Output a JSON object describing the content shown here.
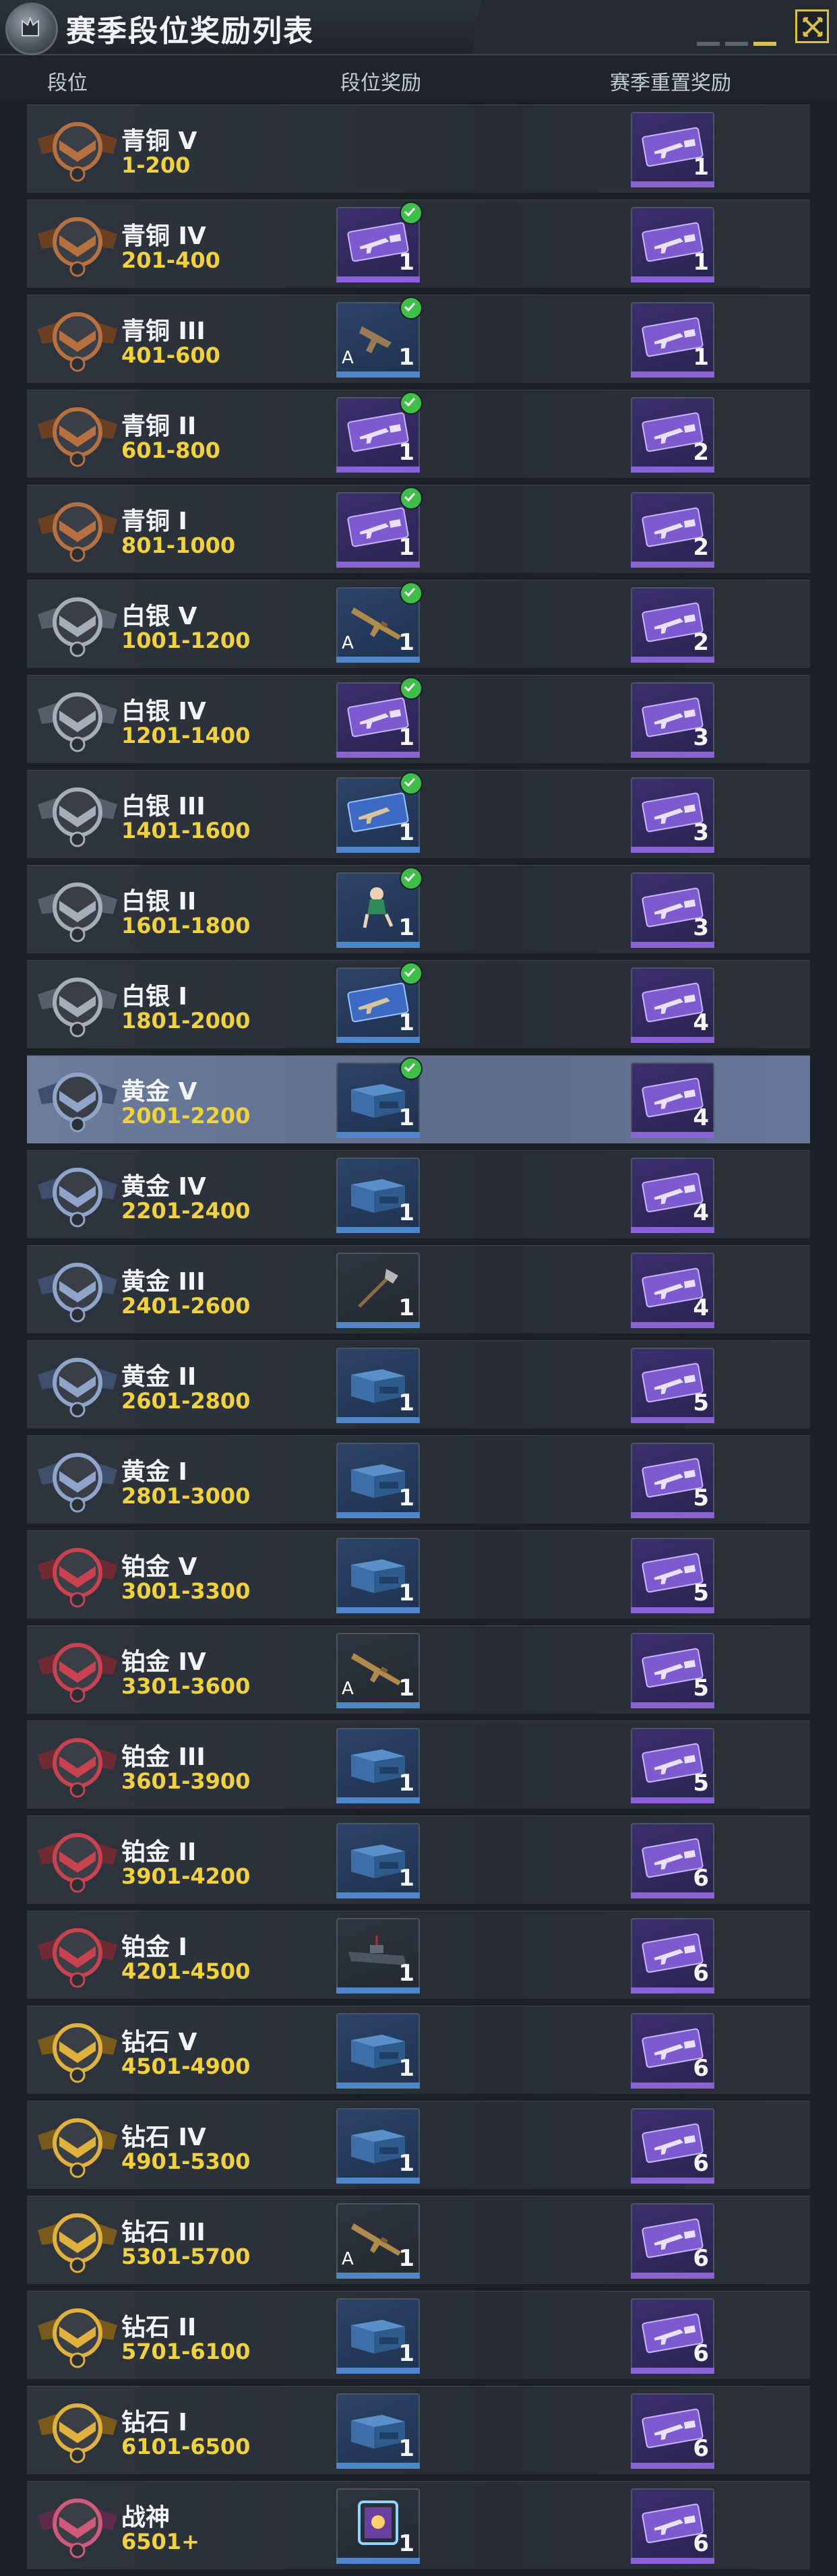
{
  "window": {
    "title": "赛季段位奖励列表"
  },
  "columns": {
    "rank": "段位",
    "rank_reward": "段位奖励",
    "reset_reward": "赛季重置奖励"
  },
  "rows": [
    {
      "name": "青铜 V",
      "range": "1-200",
      "tier": "bronze",
      "reward": null,
      "reset_count": "1"
    },
    {
      "name": "青铜 IV",
      "range": "201-400",
      "tier": "bronze",
      "reward": {
        "icon": "xp-card-icon",
        "style": "purple",
        "count": "1",
        "claimed": true
      },
      "reset_count": "1"
    },
    {
      "name": "青铜 III",
      "range": "401-600",
      "tier": "bronze",
      "reward": {
        "icon": "pistol-icon",
        "style": "blue",
        "count": "1",
        "claimed": true,
        "a_mark": "A"
      },
      "reset_count": "1"
    },
    {
      "name": "青铜 II",
      "range": "601-800",
      "tier": "bronze",
      "reward": {
        "icon": "xp-card-icon",
        "style": "purple",
        "count": "1",
        "claimed": true
      },
      "reset_count": "2"
    },
    {
      "name": "青铜 I",
      "range": "801-1000",
      "tier": "bronze",
      "reward": {
        "icon": "xp-card-icon",
        "style": "purple",
        "count": "1",
        "claimed": true
      },
      "reset_count": "2"
    },
    {
      "name": "白银 V",
      "range": "1001-1200",
      "tier": "silver",
      "reward": {
        "icon": "rifle-icon",
        "style": "blue",
        "count": "1",
        "claimed": true,
        "a_mark": "A"
      },
      "reset_count": "2"
    },
    {
      "name": "白银 IV",
      "range": "1201-1400",
      "tier": "silver",
      "reward": {
        "icon": "xp-card-icon",
        "style": "purple",
        "count": "1",
        "claimed": true
      },
      "reset_count": "3"
    },
    {
      "name": "白银 III",
      "range": "1401-1600",
      "tier": "silver",
      "reward": {
        "icon": "weapon-xp-card-icon",
        "style": "blue",
        "count": "1",
        "claimed": true
      },
      "reset_count": "3"
    },
    {
      "name": "白银 II",
      "range": "1601-1800",
      "tier": "silver",
      "reward": {
        "icon": "character-icon",
        "style": "blue",
        "count": "1",
        "claimed": true
      },
      "reset_count": "3"
    },
    {
      "name": "白银 I",
      "range": "1801-2000",
      "tier": "silver",
      "reward": {
        "icon": "weapon-xp-card-icon",
        "style": "blue",
        "count": "1",
        "claimed": true
      },
      "reset_count": "4"
    },
    {
      "name": "黄金 V",
      "range": "2001-2200",
      "tier": "gold",
      "reward": {
        "icon": "crate-icon",
        "style": "blue",
        "count": "1",
        "claimed": true
      },
      "reset_count": "4",
      "selected": true
    },
    {
      "name": "黄金 IV",
      "range": "2201-2400",
      "tier": "gold",
      "reward": {
        "icon": "crate-icon",
        "style": "blue",
        "count": "1",
        "claimed": false
      },
      "reset_count": "4"
    },
    {
      "name": "黄金 III",
      "range": "2401-2600",
      "tier": "gold",
      "reward": {
        "icon": "axe-icon",
        "style": "grey",
        "count": "1",
        "claimed": false
      },
      "reset_count": "4"
    },
    {
      "name": "黄金 II",
      "range": "2601-2800",
      "tier": "gold",
      "reward": {
        "icon": "crate-icon",
        "style": "blue",
        "count": "1",
        "claimed": false
      },
      "reset_count": "5"
    },
    {
      "name": "黄金 I",
      "range": "2801-3000",
      "tier": "gold",
      "reward": {
        "icon": "crate-icon",
        "style": "blue",
        "count": "1",
        "claimed": false
      },
      "reset_count": "5"
    },
    {
      "name": "铂金 V",
      "range": "3001-3300",
      "tier": "platinum",
      "reward": {
        "icon": "crate-icon",
        "style": "blue",
        "count": "1",
        "claimed": false
      },
      "reset_count": "5"
    },
    {
      "name": "铂金 IV",
      "range": "3301-3600",
      "tier": "platinum",
      "reward": {
        "icon": "rifle-icon",
        "style": "grey",
        "count": "1",
        "claimed": false,
        "a_mark": "A"
      },
      "reset_count": "5"
    },
    {
      "name": "铂金 III",
      "range": "3601-3900",
      "tier": "platinum",
      "reward": {
        "icon": "crate-icon",
        "style": "blue",
        "count": "1",
        "claimed": false
      },
      "reset_count": "5"
    },
    {
      "name": "铂金 II",
      "range": "3901-4200",
      "tier": "platinum",
      "reward": {
        "icon": "crate-icon",
        "style": "blue",
        "count": "1",
        "claimed": false
      },
      "reset_count": "6"
    },
    {
      "name": "铂金 I",
      "range": "4201-4500",
      "tier": "platinum",
      "reward": {
        "icon": "vehicle-icon",
        "style": "grey",
        "count": "1",
        "claimed": false
      },
      "reset_count": "6"
    },
    {
      "name": "钻石 V",
      "range": "4501-4900",
      "tier": "diamond",
      "reward": {
        "icon": "crate-icon",
        "style": "blue",
        "count": "1",
        "claimed": false
      },
      "reset_count": "6"
    },
    {
      "name": "钻石 IV",
      "range": "4901-5300",
      "tier": "diamond",
      "reward": {
        "icon": "crate-icon",
        "style": "blue",
        "count": "1",
        "claimed": false
      },
      "reset_count": "6"
    },
    {
      "name": "钻石 III",
      "range": "5301-5700",
      "tier": "diamond",
      "reward": {
        "icon": "rifle-icon",
        "style": "grey",
        "count": "1",
        "claimed": false,
        "a_mark": "A"
      },
      "reset_count": "6"
    },
    {
      "name": "钻石 II",
      "range": "5701-6100",
      "tier": "diamond",
      "reward": {
        "icon": "crate-icon",
        "style": "blue",
        "count": "1",
        "claimed": false
      },
      "reset_count": "6"
    },
    {
      "name": "钻石 I",
      "range": "6101-6500",
      "tier": "diamond",
      "reward": {
        "icon": "crate-icon",
        "style": "blue",
        "count": "1",
        "claimed": false
      },
      "reset_count": "6"
    },
    {
      "name": "战神",
      "range": "6501+",
      "tier": "legend",
      "reward": {
        "icon": "frame-icon",
        "style": "grey",
        "count": "1",
        "claimed": false
      },
      "reset_count": "6"
    }
  ],
  "colors": {
    "range_text": "#f1d23c",
    "claimed_check": "#3fbf4a",
    "selected_row": "#66779a",
    "bronze": "#b7703f",
    "silver": "#a5adb8",
    "gold": "#8ea4c8",
    "platinum": "#c8424f",
    "diamond": "#e0b13c",
    "legend": "#d05a7a"
  }
}
